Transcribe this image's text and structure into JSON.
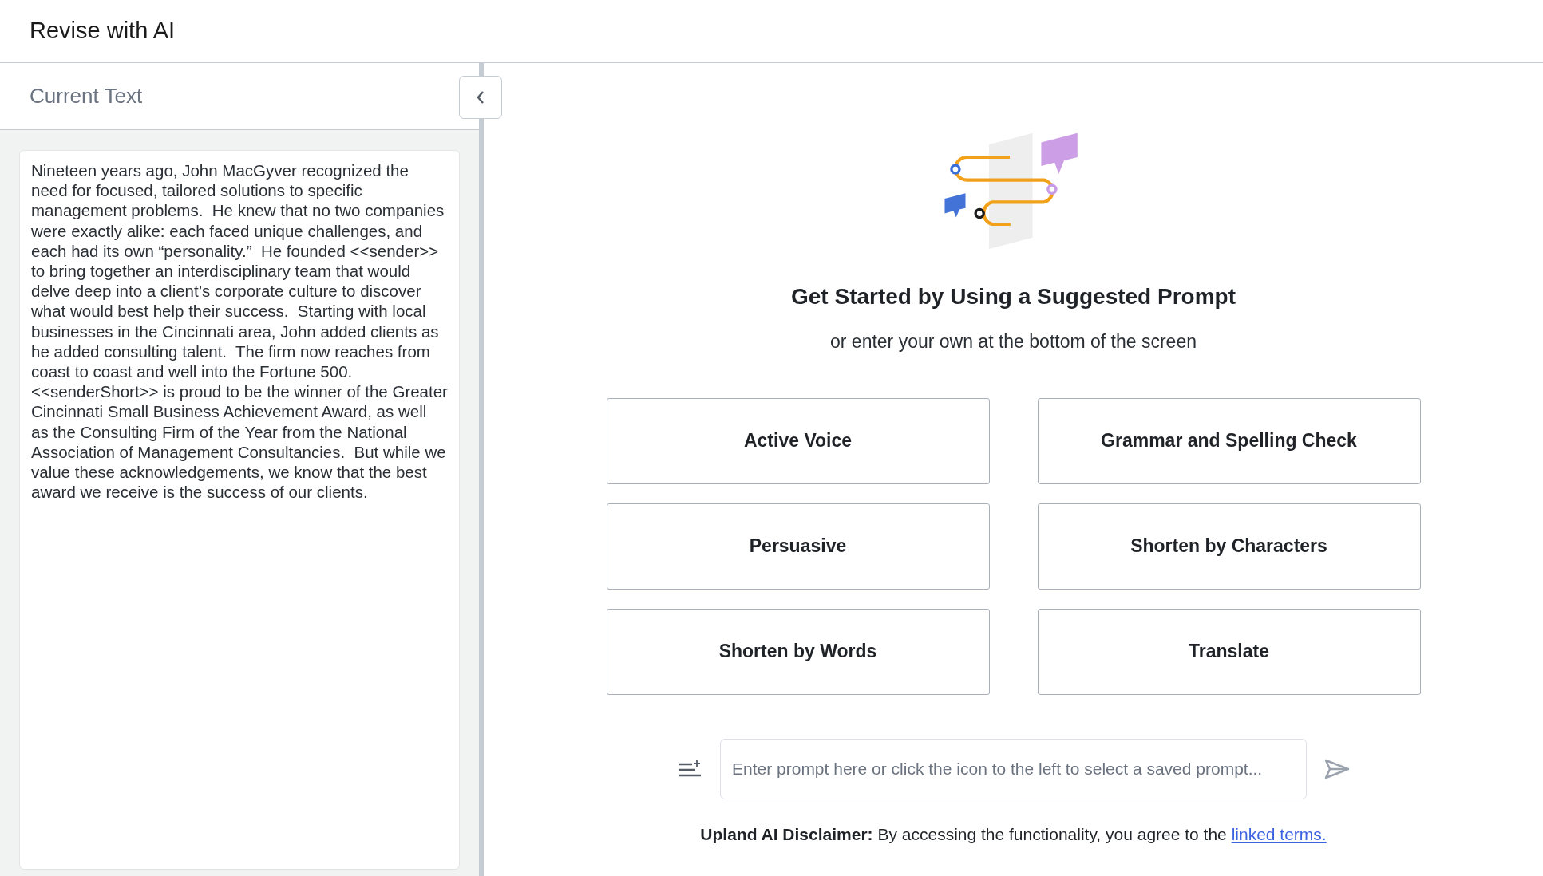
{
  "window": {
    "title": "Revise with AI"
  },
  "current_text": {
    "title": "Current Text",
    "body": "Nineteen years ago, John MacGyver recognized the need for focused, tailored solutions to specific management problems.  He knew that no two companies were exactly alike: each faced unique challenges, and each had its own “personality.”  He founded <<sender>> to bring together an interdisciplinary team that would delve deep into a client’s corporate culture to discover what would best help their success.  Starting with local businesses in the Cincinnati area, John added clients as he added consulting talent.  The firm now reaches from coast to coast and well into the Fortune 500. <<senderShort>> is proud to be the winner of the Greater Cincinnati Small Business Achievement Award, as well as the Consulting Firm of the Year from the National Association of Management Consultancies.  But while we value these acknowledgements, we know that the best award we receive is the success of our clients."
  },
  "intro": {
    "heading": "Get Started by Using a Suggested Prompt",
    "subtitle": "or enter your own at the bottom of the screen"
  },
  "suggested_prompts": [
    {
      "label": "Active Voice"
    },
    {
      "label": "Grammar and Spelling Check"
    },
    {
      "label": "Persuasive"
    },
    {
      "label": "Shorten by Characters"
    },
    {
      "label": "Shorten by Words"
    },
    {
      "label": "Translate"
    }
  ],
  "prompt": {
    "placeholder": "Enter prompt here or click the icon to the left to select a saved prompt..."
  },
  "disclaimer": {
    "label": "Upland AI Disclaimer:",
    "text": " By accessing the functionality, you agree to the ",
    "link": "linked terms."
  }
}
